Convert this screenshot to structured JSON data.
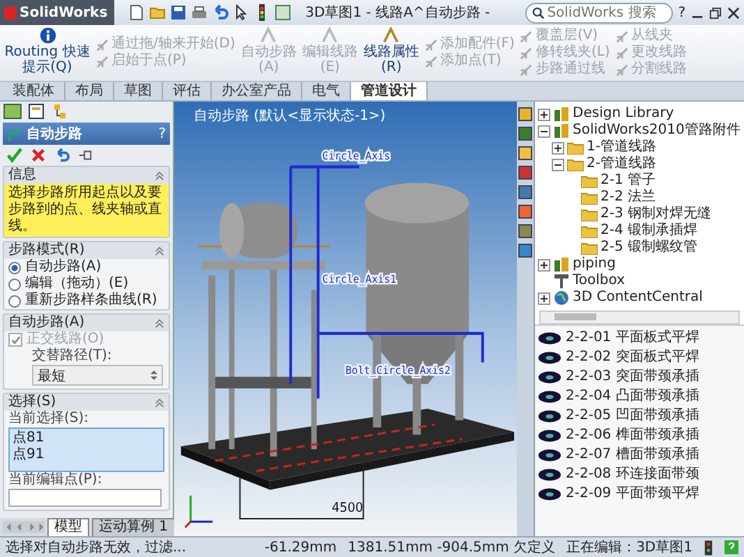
{
  "app": {
    "logo": "SolidWorks",
    "title": "3D草图1 - 线路A^自动步路 -",
    "search": {
      "placeholder": "SolidWorks 搜索"
    },
    "help": "?"
  },
  "ribbon": [
    {
      "kind": "large",
      "items": [
        {
          "label": "Routing 快速提示(Q)",
          "disabled": false
        }
      ]
    },
    {
      "kind": "stack",
      "items": [
        {
          "label": "通过拖/轴来开始(D)",
          "disabled": true
        },
        {
          "label": "启始于点(P)",
          "disabled": true
        }
      ]
    },
    {
      "kind": "large",
      "items": [
        {
          "label": "自动步路(A)",
          "disabled": true
        }
      ]
    },
    {
      "kind": "large",
      "items": [
        {
          "label": "编辑线路(E)",
          "disabled": true
        }
      ]
    },
    {
      "kind": "large",
      "items": [
        {
          "label": "线路属性(R)",
          "disabled": false
        }
      ]
    },
    {
      "kind": "stack",
      "items": [
        {
          "label": "添加配件(F)",
          "disabled": true
        },
        {
          "label": "添加点(T)",
          "disabled": true
        }
      ]
    },
    {
      "kind": "stack",
      "items": [
        {
          "label": "覆盖层(V)",
          "disabled": true
        },
        {
          "label": "修转线夹(L)",
          "disabled": true
        },
        {
          "label": "步路通过线",
          "disabled": true
        }
      ]
    },
    {
      "kind": "stack",
      "items": [
        {
          "label": "从线夹",
          "disabled": true
        },
        {
          "label": "更改线路",
          "disabled": true
        },
        {
          "label": "分割线路",
          "disabled": true
        }
      ]
    }
  ],
  "tabs": [
    {
      "label": "装配体",
      "selected": false
    },
    {
      "label": "布局",
      "selected": false
    },
    {
      "label": "草图",
      "selected": false
    },
    {
      "label": "评估",
      "selected": false
    },
    {
      "label": "办公室产品",
      "selected": false
    },
    {
      "label": "电气",
      "selected": false
    },
    {
      "label": "管道设计",
      "selected": true
    }
  ],
  "property_manager": {
    "title": "自动步路",
    "help": "?",
    "sections": [
      {
        "kind": "message",
        "title": "信息",
        "text": "选择步路所用起点以及要步路到的点、线夹轴或直线。"
      },
      {
        "kind": "radios",
        "title": "步路模式(R)",
        "options": [
          {
            "label": "自动步路(A)",
            "selected": true
          },
          {
            "label": "编辑（拖动）(E)",
            "selected": false
          },
          {
            "label": "重新步路样条曲线(R)",
            "selected": false
          }
        ]
      },
      {
        "kind": "auto",
        "title": "自动步路(A)",
        "checkbox": {
          "label": "正交线路(O)",
          "checked": true,
          "disabled": true
        },
        "field_label": "交替路径(T):",
        "value": "最短"
      },
      {
        "kind": "selection",
        "title": "选择(S)",
        "list_label": "当前选择(S):",
        "items": [
          "点81",
          "点91"
        ],
        "point_label": "当前编辑点(P):"
      }
    ]
  },
  "bottom_tabs": [
    {
      "label": "模型",
      "selected": true
    },
    {
      "label": "运动算例 1",
      "selected": false
    }
  ],
  "viewport": {
    "breadcrumb": "自动步路 (默认<显示状态-1>)",
    "axis_labels": [
      "Circle_Axis",
      "Circle_Axis1",
      "Bolt_Circle_Axis2"
    ],
    "dimension": "4500"
  },
  "task_pane": {
    "tree": [
      {
        "label": "Design Library",
        "kind": "library",
        "expanded": false
      },
      {
        "label": "SolidWorks2010管路附件",
        "kind": "library",
        "expanded": true,
        "children": [
          {
            "label": "1-管道线路",
            "kind": "folder",
            "expanded": false
          },
          {
            "label": "2-管道线路",
            "kind": "folder",
            "expanded": true,
            "children": [
              {
                "label": "2-1 管子",
                "kind": "folder"
              },
              {
                "label": "2-2 法兰",
                "kind": "folder"
              },
              {
                "label": "2-3 钢制对焊无缝",
                "kind": "folder"
              },
              {
                "label": "2-4 锻制承插焊",
                "kind": "folder"
              },
              {
                "label": "2-5 锻制螺纹管",
                "kind": "folder"
              }
            ]
          }
        ]
      },
      {
        "label": "piping",
        "kind": "library",
        "expanded": false
      },
      {
        "label": "Toolbox",
        "kind": "toolbox"
      },
      {
        "label": "3D ContentCentral",
        "kind": "globe",
        "expanded": false
      }
    ],
    "parts": [
      "2-2-01 平面板式平焊",
      "2-2-02 突面板式平焊",
      "2-2-03 突面带颈承插",
      "2-2-04 凸面带颈承插",
      "2-2-05 凹面带颈承插",
      "2-2-06 榫面带颈承插",
      "2-2-07 槽面带颈承插",
      "2-2-08 环连接面带颈",
      "2-2-09 平面带颈平焊"
    ]
  },
  "status_bar": [
    "选择对自动步路无效，过滤...",
    "-61.29mm",
    "1381.51mm -904.5mm 欠定义",
    "正在编辑：3D草图1"
  ]
}
